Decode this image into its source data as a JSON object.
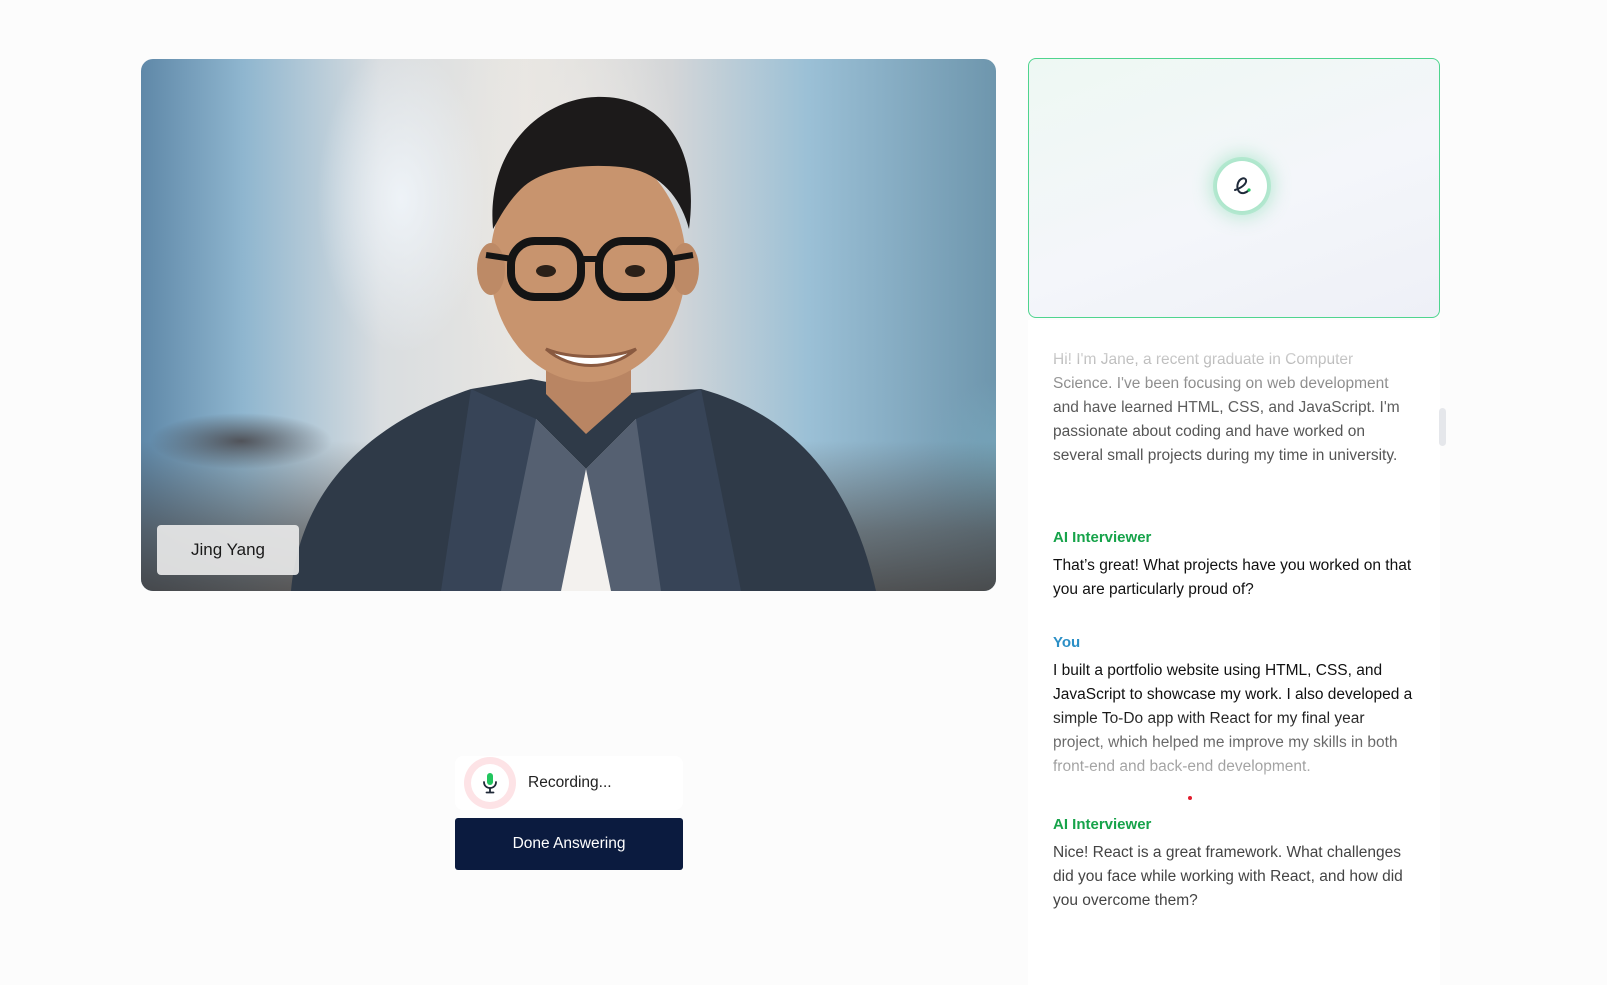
{
  "video": {
    "participant_name": "Jing Yang"
  },
  "ai_panel": {
    "avatar_icon": "e-logo-icon",
    "accent_color": "#4fd48e"
  },
  "transcript": {
    "messages": [
      {
        "speaker": "",
        "text": "Hi! I'm Jane, a recent graduate in Computer Science. I've been focusing on web development and have learned HTML, CSS, and JavaScript. I'm passionate about coding and have worked on several small projects during my time in university."
      },
      {
        "speaker": "AI Interviewer",
        "text": "That’s great! What projects have you worked on that you are particularly proud of?"
      },
      {
        "speaker": "You",
        "text": "I built a portfolio website using HTML, CSS, and JavaScript to showcase my work. I also developed a simple To-Do app with React for my final year project, which helped me improve my skills in both front-end and back-end development."
      },
      {
        "speaker": "AI Interviewer",
        "text": "Nice! React is a great framework. What challenges did you face while working with React, and how did you overcome them?"
      }
    ]
  },
  "controls": {
    "recording_label": "Recording...",
    "done_button": "Done Answering",
    "mic_icon": "microphone-icon",
    "recording_color": "#fde3e6",
    "button_color": "#0b1b3f"
  }
}
